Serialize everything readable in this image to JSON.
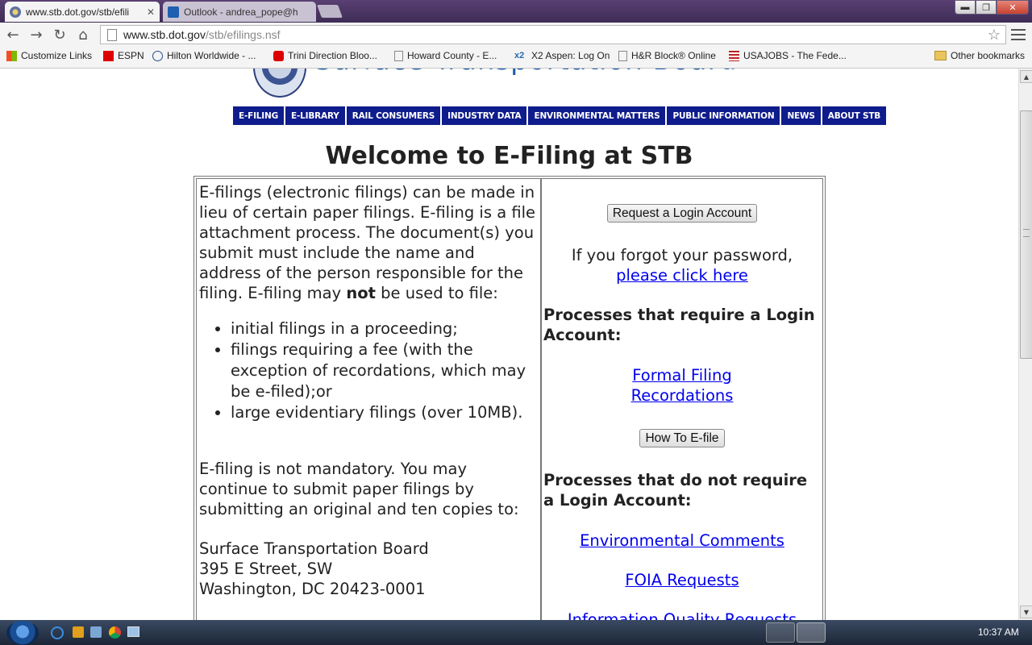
{
  "browser": {
    "tabs": [
      {
        "label": "www.stb.dot.gov/stb/efili",
        "close": "✕"
      },
      {
        "label": "Outlook - andrea_pope@h"
      }
    ],
    "address": {
      "host": "www.stb.dot.gov",
      "path": "/stb/efilings.nsf"
    },
    "bookmarks": [
      {
        "label": "Customize Links",
        "icon": "windows-icon"
      },
      {
        "label": "ESPN",
        "icon": "espn-icon"
      },
      {
        "label": "Hilton Worldwide - ...",
        "icon": "hilton-icon"
      },
      {
        "label": "Trini Direction Bloo...",
        "icon": "youtube-icon"
      },
      {
        "label": "Howard County - E...",
        "icon": "page-icon"
      },
      {
        "label": "X2 Aspen: Log On",
        "icon": "x2-icon"
      },
      {
        "label": "H&R Block® Online",
        "icon": "page-icon"
      },
      {
        "label": "USAJOBS - The Fede...",
        "icon": "usajobs-icon"
      }
    ],
    "other_bookmarks": "Other bookmarks"
  },
  "site": {
    "logo_text": "Surface Transportation Board",
    "nav": [
      "E-FILING",
      "E-LIBRARY",
      "RAIL CONSUMERS",
      "INDUSTRY DATA",
      "ENVIRONMENTAL MATTERS",
      "PUBLIC INFORMATION",
      "NEWS",
      "ABOUT STB"
    ]
  },
  "page": {
    "title": "Welcome to E-Filing at STB",
    "left": {
      "intro": "E-filings (electronic filings) can be made in lieu of certain paper filings. E-filing is a file attachment process. The document(s) you submit must include the name and address of the person responsible for the filing. E-filing may ",
      "not_word": "not",
      "intro_end": " be used to file:",
      "bullets": [
        "initial filings in a proceeding;",
        "filings requiring a fee (with the exception of recordations, which may be e-filed);or",
        "large evidentiary filings (over 10MB)."
      ],
      "mandatory": "E-filing is not mandatory. You may continue to submit paper filings by submitting an original and ten copies to:",
      "address": [
        "Surface Transportation Board",
        "395 E Street, SW",
        "Washington, DC 20423-0001"
      ]
    },
    "right": {
      "request_button": "Request a Login Account",
      "forgot_text": "If you forgot your password,",
      "forgot_link": "please click here",
      "login_heading": "Processes that require a Login Account:",
      "login_links": [
        "Formal Filing",
        "Recordations"
      ],
      "howto_button": "How To E-file",
      "nologin_heading": "Processes that do not require a Login Account:",
      "nologin_links": [
        "Environmental Comments",
        "FOIA Requests",
        "Information Quality Requests"
      ]
    }
  },
  "taskbar": {
    "clock": "10:37 AM"
  }
}
